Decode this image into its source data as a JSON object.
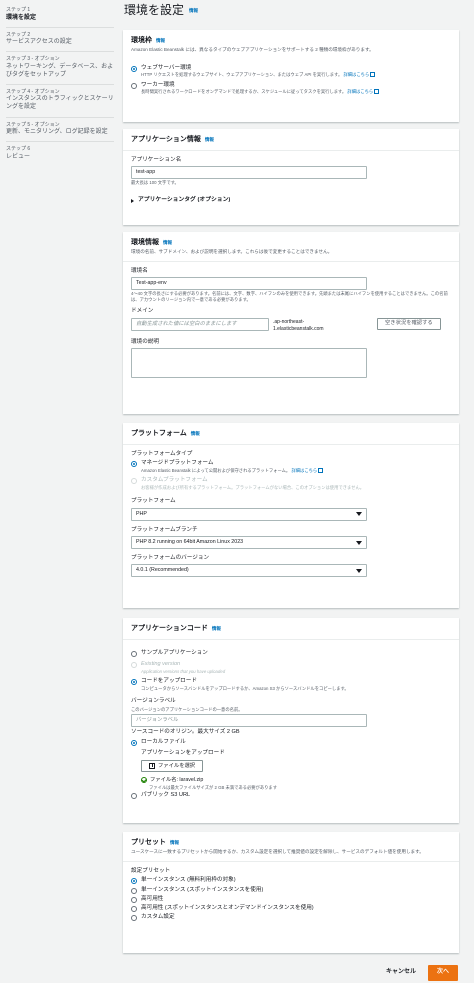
{
  "sidebar": {
    "steps": [
      {
        "num": "ステップ 1",
        "title": "環境を設定"
      },
      {
        "num": "ステップ 2",
        "title": "サービスアクセスの設定"
      },
      {
        "num": "ステップ 3 - オプション",
        "title": "ネットワーキング、データベース、およびタグをセットアップ"
      },
      {
        "num": "ステップ 4 - オプション",
        "title": "インスタンスのトラフィックとスケーリングを設定"
      },
      {
        "num": "ステップ 5 - オプション",
        "title": "更新、モニタリング、ログ記録を設定"
      },
      {
        "num": "ステップ 6",
        "title": "レビュー"
      }
    ]
  },
  "page": {
    "title": "環境を設定",
    "info": "情報"
  },
  "tier": {
    "title": "環境枠",
    "info": "情報",
    "desc": "Amazon Elastic Beanstalk には、異なるタイプのウェブアプリケーションをサポートする 2 種類の環境枠があります。",
    "web": {
      "label": "ウェブサーバー環境",
      "desc": "HTTP リクエストを処理するウェブサイト、ウェブアプリケーション、またはウェブ API を実行します。",
      "link": "詳細はこちら"
    },
    "worker": {
      "label": "ワーカー環境",
      "desc": "長時間実行されるワークロードをオンデマンドで処理するか、スケジュールに従ってタスクを実行します。",
      "link": "詳細はこちら"
    }
  },
  "appinfo": {
    "title": "アプリケーション情報",
    "info": "情報",
    "name_label": "アプリケーション名",
    "name_value": "test-app",
    "name_hint": "最大長は 100 文字です。",
    "tags": "アプリケーションタグ (オプション)"
  },
  "envinfo": {
    "title": "環境情報",
    "info": "情報",
    "desc": "環境の名前、サブドメイン、および説明を選択します。これらは後で変更することはできません。",
    "name_label": "環境名",
    "name_value": "Test-app-env",
    "name_hint": "4～40 文字の長さにする必要があります。名前には、文字、数字、ハイフンのみを使用できます。先頭または末尾にハイフンを使用することはできません。この名前は、アカウントのリージョン内で一意である必要があります。",
    "domain_label": "ドメイン",
    "domain_placeholder": "自動生成された値には空白のままにします",
    "domain_suffix": ".ap-northeast-1.elasticbeanstalk.com",
    "check_button": "空き状況を確認する",
    "desc_label": "環境の説明"
  },
  "platform": {
    "title": "プラットフォーム",
    "info": "情報",
    "type_label": "プラットフォームタイプ",
    "managed": {
      "label": "マネージドプラットフォーム",
      "desc": "Amazon Elastic Beanstalk によって公開および保守されるプラットフォーム。",
      "link": "詳細はこちら"
    },
    "custom": {
      "label": "カスタムプラットフォーム",
      "desc": "お客様が作成および所有するプラットフォーム。プラットフォームがない場合、このオプションは使用できません。"
    },
    "platform_label": "プラットフォーム",
    "platform_value": "PHP",
    "branch_label": "プラットフォームブランチ",
    "branch_value": "PHP 8.2 running on 64bit Amazon Linux 2023",
    "version_label": "プラットフォームのバージョン",
    "version_value": "4.0.1 (Recommended)"
  },
  "code": {
    "title": "アプリケーションコード",
    "info": "情報",
    "sample": "サンプルアプリケーション",
    "existing": {
      "label": "Existing version",
      "desc": "Application versions that you have uploaded"
    },
    "upload": {
      "label": "コードをアップロード",
      "desc": "コンピュータからソースバンドルをアップロードするか、Amazon S3 からソースバンドルをコピーします。"
    },
    "version_label": "バージョンラベル",
    "version_hint": "このバージョンのアプリケーションコードの一意の名前。",
    "version_placeholder": "バージョンラベル",
    "origin_label": "ソースコードのオリジン。最大サイズ 2 GB",
    "local": "ローカルファイル",
    "upload_label": "アプリケーションをアップロード",
    "choose_button": "ファイルを選択",
    "file_name": "ファイル名: laravel.zip",
    "file_hint": "ファイルは最大ファイルサイズが 2 GB 未満である必要があります",
    "s3": "パブリック S3 URL"
  },
  "preset": {
    "title": "プリセット",
    "info": "情報",
    "desc": "ユースケースに一致するプリセットから開始するか、カスタム設定を選択して推奨値の設定を解除し、サービスのデフォルト値を使用します。",
    "options_label": "設定プリセット",
    "options": [
      "単一インスタンス (無料利用枠の対象)",
      "単一インスタンス (スポットインスタンスを使用)",
      "高可用性",
      "高可用性 (スポットインスタンスとオンデマンドインスタンスを使用)",
      "カスタム設定"
    ]
  },
  "footer": {
    "cancel": "キャンセル",
    "next": "次へ"
  }
}
